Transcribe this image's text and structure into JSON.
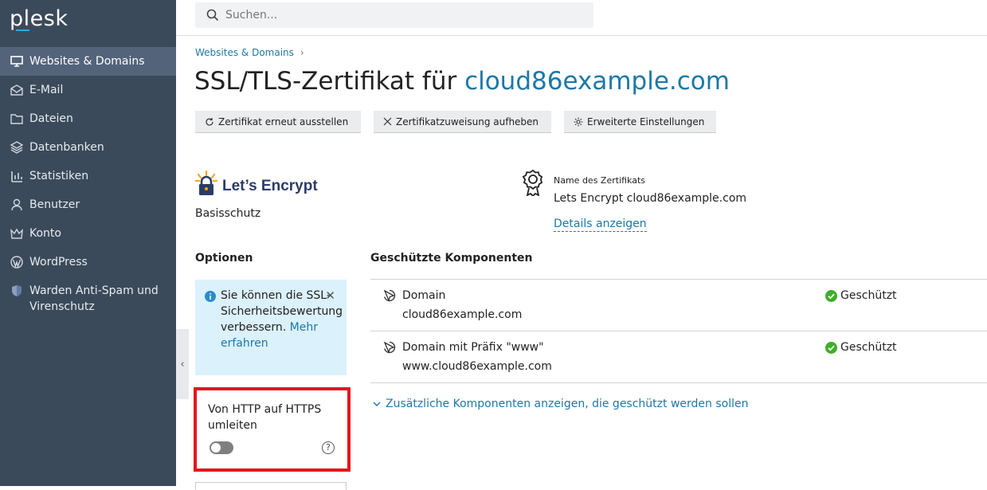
{
  "app": {
    "logo": "plesk"
  },
  "sidebar": {
    "items": [
      {
        "label": "Websites & Domains",
        "icon": "monitor-icon",
        "active": true
      },
      {
        "label": "E-Mail",
        "icon": "mail-icon"
      },
      {
        "label": "Dateien",
        "icon": "folder-icon"
      },
      {
        "label": "Datenbanken",
        "icon": "database-icon"
      },
      {
        "label": "Statistiken",
        "icon": "bar-chart-icon"
      },
      {
        "label": "Benutzer",
        "icon": "user-icon"
      },
      {
        "label": "Konto",
        "icon": "crown-icon"
      },
      {
        "label": "WordPress",
        "icon": "wordpress-icon"
      },
      {
        "label": "Warden Anti-Spam und Virenschutz",
        "icon": "shield-icon"
      }
    ]
  },
  "search": {
    "placeholder": "Suchen..."
  },
  "breadcrumb": {
    "label": "Websites & Domains",
    "separator": "›"
  },
  "page": {
    "title_prefix": "SSL/TLS-Zertifikat für ",
    "title_domain": "cloud86example.com"
  },
  "toolbar": {
    "reissue_label": "Zertifikat erneut ausstellen",
    "unassign_label": "Zertifikatzuweisung aufheben",
    "advanced_label": "Erweiterte Einstellungen"
  },
  "provider": {
    "name": "Let’s Encrypt",
    "level": "Basisschutz"
  },
  "certificate": {
    "label": "Name des Zertifikats",
    "name": "Lets Encrypt cloud86example.com",
    "details_link": "Details anzeigen"
  },
  "options": {
    "heading": "Optionen",
    "info_text": "Sie können die SSL-Sicherheitsbewertung verbessern.",
    "info_link": "Mehr erfahren",
    "redirect_label": "Von HTTP auf HTTPS umleiten",
    "redirect_enabled": false,
    "help_glyph": "?"
  },
  "components": {
    "heading": "Geschützte Komponenten",
    "rows": [
      {
        "name": "Domain",
        "host": "cloud86example.com",
        "status": "Geschützt"
      },
      {
        "name": "Domain mit Präfix \"www\"",
        "host": "www.cloud86example.com",
        "status": "Geschützt"
      }
    ],
    "more_link": "Zusätzliche Komponenten anzeigen, die geschützt werden sollen"
  },
  "colors": {
    "sidebar_bg": "#3b4a5a",
    "accent": "#1c78a8",
    "status_ok": "#3fae29",
    "highlight_border": "#e8131a",
    "info_bg": "#dbf1fb"
  }
}
